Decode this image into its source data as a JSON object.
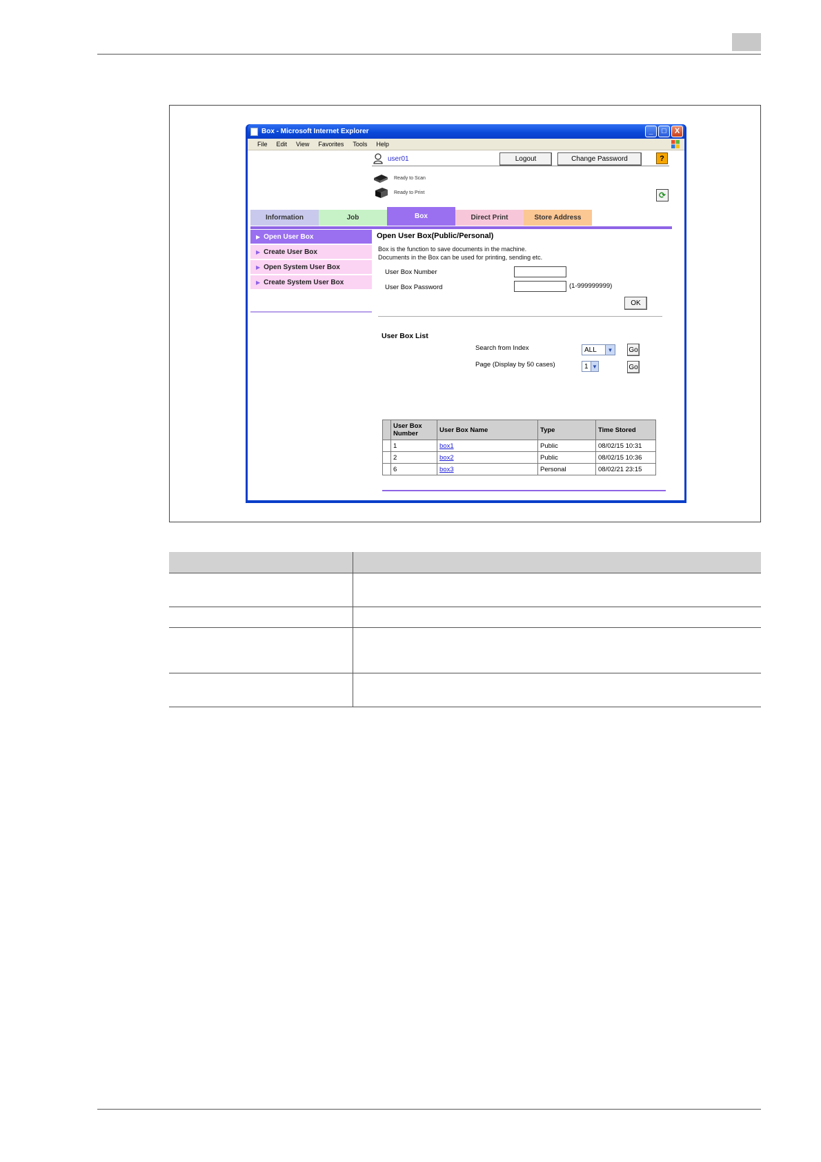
{
  "window": {
    "title": "Box - Microsoft Internet Explorer",
    "buttons": {
      "minimize": "_",
      "maximize": "□",
      "close": "X"
    },
    "menu": [
      "File",
      "Edit",
      "View",
      "Favorites",
      "Tools",
      "Help"
    ]
  },
  "header": {
    "user": "user01",
    "logout_label": "Logout",
    "change_password_label": "Change Password",
    "help_label": "?",
    "status_scan": "Ready to Scan",
    "status_print": "Ready to Print"
  },
  "tabs": [
    {
      "label": "Information",
      "color": "#c9c9ee"
    },
    {
      "label": "Job",
      "color": "#c7f2c7"
    },
    {
      "label": "Box",
      "color": "#9a6ff0"
    },
    {
      "label": "Direct Print",
      "color": "#f7c7d9"
    },
    {
      "label": "Store Address",
      "color": "#fbc793"
    }
  ],
  "sidebar": {
    "items": [
      {
        "label": "Open User Box"
      },
      {
        "label": "Create User Box"
      },
      {
        "label": "Open System User Box"
      },
      {
        "label": "Create System User Box"
      }
    ]
  },
  "main": {
    "title": "Open User Box(Public/Personal)",
    "description_1": "Box is the function to save documents in the machine.",
    "description_2": "Documents in the Box can be used for printing, sending etc.",
    "box_number_label": "User Box Number",
    "box_number_range": "(1-999999999)",
    "box_password_label": "User Box Password",
    "ok_label": "OK"
  },
  "list": {
    "title": "User Box List",
    "search_label": "Search from Index",
    "search_value": "ALL",
    "page_label": "Page (Display by 50 cases)",
    "page_value": "1",
    "go_label": "Go",
    "columns": [
      "User Box Number",
      "User Box Name",
      "Type",
      "Time Stored"
    ],
    "rows": [
      {
        "number": "1",
        "name": "box1",
        "type": "Public",
        "time": "08/02/15 10:31"
      },
      {
        "number": "2",
        "name": "box2",
        "type": "Public",
        "time": "08/02/15 10:36"
      },
      {
        "number": "6",
        "name": "box3",
        "type": "Personal",
        "time": "08/02/21 23:15"
      }
    ]
  },
  "colors": {
    "accent": "#8f64e6",
    "sidebar_inactive": "#fbd3f3",
    "link": "#1a1ad6",
    "title_bar": "#0a3ec9"
  }
}
